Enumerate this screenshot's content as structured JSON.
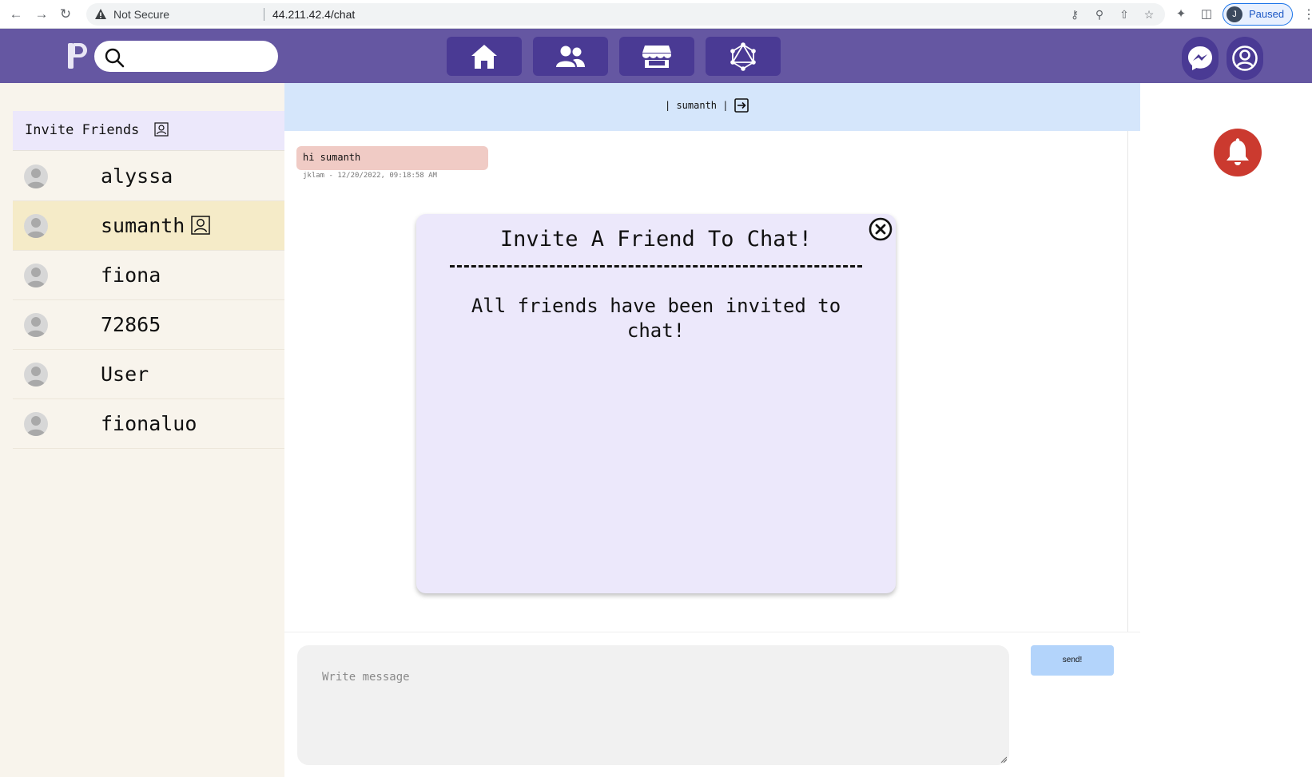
{
  "browser": {
    "security_label": "Not Secure",
    "url": "44.211.42.4/chat",
    "profile_initial": "J",
    "profile_status": "Paused",
    "icons": [
      "back-icon",
      "forward-icon",
      "reload-icon",
      "warning-icon",
      "key-icon",
      "zoom-icon",
      "share-icon",
      "star-icon",
      "extensions-icon",
      "sidepanel-icon",
      "menu-icon"
    ]
  },
  "header": {
    "search_placeholder": "",
    "nav": [
      "home-icon",
      "friends-icon",
      "store-icon",
      "network-icon"
    ],
    "colors": {
      "bar": "#6557a2",
      "tile": "#4a3a94"
    }
  },
  "sidebar": {
    "invite_label": "Invite Friends",
    "friends": [
      {
        "name": "alyssa",
        "active": false
      },
      {
        "name": "sumanth",
        "active": true
      },
      {
        "name": "fiona",
        "active": false
      },
      {
        "name": "72865",
        "active": false
      },
      {
        "name": "User",
        "active": false
      },
      {
        "name": "fionaluo",
        "active": false
      }
    ]
  },
  "chat": {
    "header_text": "| sumanth |",
    "messages": [
      {
        "text": "hi sumanth",
        "meta": "jklam - 12/20/2022, 09:18:58 AM"
      }
    ],
    "composer_placeholder": "Write message",
    "send_label": "send!"
  },
  "modal": {
    "title": "Invite A Friend To Chat!",
    "body": "All friends have been invited to chat!"
  }
}
